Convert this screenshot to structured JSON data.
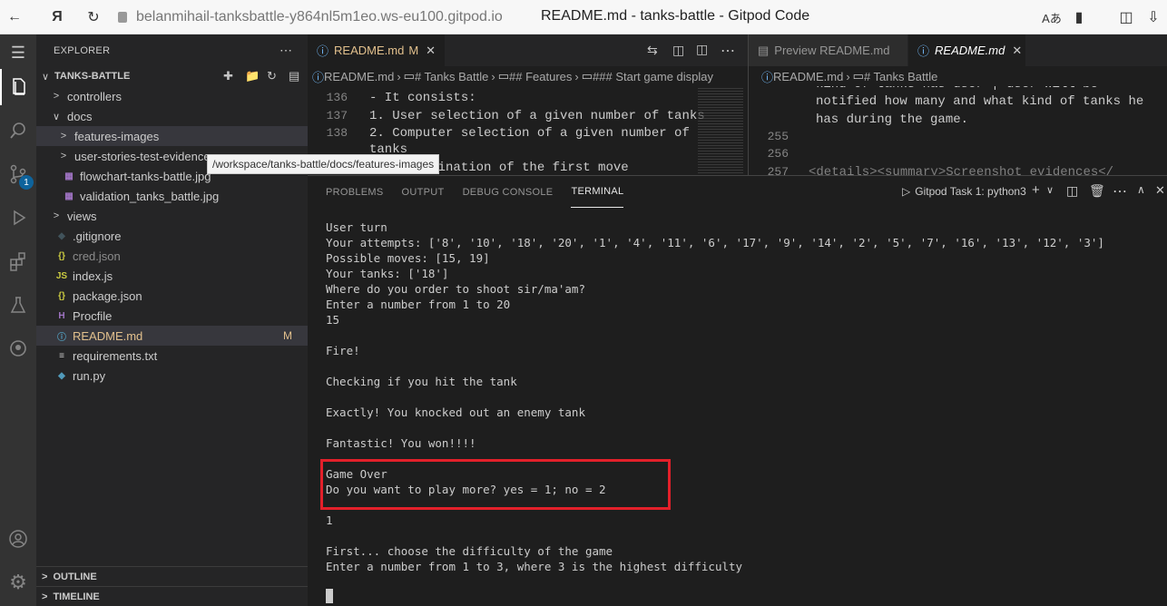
{
  "browser": {
    "url": "belanmihail-tanksbattle-y864nl5m1eo.ws-eu100.gitpod.io",
    "title": "README.md - tanks-battle - Gitpod Code"
  },
  "activity": {
    "badge": "1"
  },
  "explorer": {
    "header": "EXPLORER",
    "root": "TANKS-BATTLE",
    "items": [
      {
        "label": "controllers",
        "type": "folder"
      },
      {
        "label": "docs",
        "type": "folder-open"
      },
      {
        "label": "features-images",
        "type": "folder"
      },
      {
        "label": "user-stories-test-evidence",
        "type": "folder"
      },
      {
        "label": "flowchart-tanks-battle.jpg",
        "type": "image"
      },
      {
        "label": "validation_tanks_battle.jpg",
        "type": "image"
      },
      {
        "label": "views",
        "type": "folder"
      },
      {
        "label": ".gitignore",
        "type": "git"
      },
      {
        "label": "cred.json",
        "type": "json"
      },
      {
        "label": "index.js",
        "type": "js"
      },
      {
        "label": "package.json",
        "type": "json"
      },
      {
        "label": "Procfile",
        "type": "heroku"
      },
      {
        "label": "README.md",
        "type": "md",
        "badge": "M"
      },
      {
        "label": "requirements.txt",
        "type": "txt"
      },
      {
        "label": "run.py",
        "type": "py"
      }
    ],
    "tooltip": "/workspace/tanks-battle/docs/features-images",
    "outline": "OUTLINE",
    "timeline": "TIMELINE"
  },
  "editor_left": {
    "tab": "README.md",
    "tab_badge": "M",
    "breadcrumb": [
      "README.md",
      "# Tanks Battle",
      "## Features",
      "### Start game display"
    ],
    "lines": [
      {
        "num": "136",
        "text": "- It consists:"
      },
      {
        "num": "137",
        "text": "1. User selection of a given number of tanks"
      },
      {
        "num": "138",
        "text": "2. Computer selection of a given number of"
      },
      {
        "num": "",
        "text": "tanks"
      },
      {
        "num": "",
        "text": "3. Determination of the first move"
      }
    ]
  },
  "editor_right": {
    "tabs": [
      "Preview README.md",
      "README.md"
    ],
    "breadcrumb": [
      "README.md",
      "# Tanks Battle"
    ],
    "lines": [
      {
        "num": "",
        "text": "kind of tanks has user | user will be"
      },
      {
        "num": "",
        "text": "notified how many and what kind of tanks he"
      },
      {
        "num": "",
        "text": "has during the game."
      },
      {
        "num": "255",
        "text": ""
      },
      {
        "num": "256",
        "text": ""
      },
      {
        "num": "257",
        "text": "<details><summary>Screenshot evidences</"
      }
    ]
  },
  "panel": {
    "tabs": [
      "PROBLEMS",
      "OUTPUT",
      "DEBUG CONSOLE",
      "TERMINAL"
    ],
    "task": "Gitpod Task 1: python3",
    "terminal_lines": [
      "User turn",
      "Your attempts: ['8', '10', '18', '20', '1', '4', '11', '6', '17', '9', '14', '2', '5', '7', '16', '13', '12', '3']",
      "Possible moves: [15, 19]",
      "Your tanks: ['18']",
      "Where do you order to shoot sir/ma'am?",
      "Enter a number from 1 to 20",
      "15",
      "",
      "Fire!",
      "",
      "Checking if you hit the tank",
      "",
      "Exactly! You knocked out an enemy tank",
      "",
      "Fantastic! You won!!!!",
      "",
      "Game Over",
      "Do you want to play more? yes = 1; no = 2",
      "",
      "1",
      "",
      "First... choose the difficulty of the game",
      "Enter a number from 1 to 3, where 3 is the highest difficulty"
    ]
  }
}
